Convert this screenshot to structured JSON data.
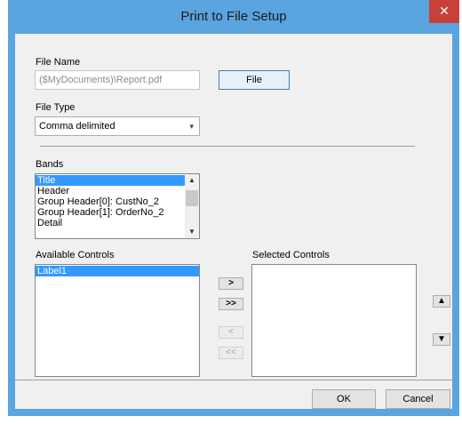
{
  "window": {
    "title": "Print to File Setup",
    "close_glyph": "✕"
  },
  "file_name": {
    "label": "File Name",
    "value": "($MyDocuments)\\Report.pdf",
    "button": "File"
  },
  "file_type": {
    "label": "File Type",
    "value": "Comma delimited",
    "arrow": "▾"
  },
  "bands": {
    "label": "Bands",
    "items": [
      "Title",
      "Header",
      "Group Header[0]: CustNo_2",
      "Group Header[1]: OrderNo_2",
      "Detail"
    ],
    "selected_index": 0
  },
  "available_controls": {
    "label": "Available Controls",
    "items": [
      "Label1"
    ],
    "selected_index": 0
  },
  "selected_controls": {
    "label": "Selected Controls",
    "items": []
  },
  "move_buttons": {
    "add": ">",
    "add_all": ">>",
    "remove": "<",
    "remove_all": "<<"
  },
  "order_buttons": {
    "up": "🡅",
    "down": "🡇"
  },
  "footer": {
    "ok": "OK",
    "cancel": "Cancel"
  },
  "colors": {
    "title_bar": "#5aa4e0",
    "close": "#c7413a",
    "selection": "#3399ff"
  }
}
